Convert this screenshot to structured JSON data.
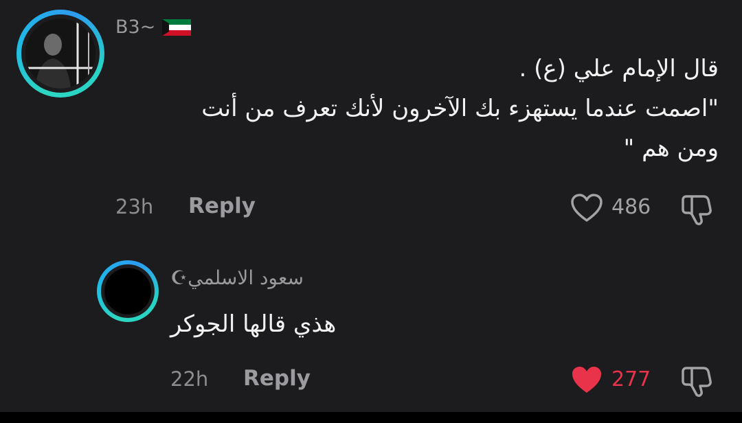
{
  "colors": {
    "background": "#1c1c1e",
    "text": "#f2f2f2",
    "muted": "#8d8d91",
    "liked": "#e8334a",
    "ring": "#2dd6c1"
  },
  "comments": [
    {
      "username": "B3~",
      "badge_icon": "kuwait-flag-icon",
      "lines": [
        "قال الإمام علي (ع) .",
        "\"اصمت عندما يستهزء بك الآخرون لأنك تعرف من أنت",
        "ومن هم \""
      ],
      "time": "23h",
      "reply_label": "Reply",
      "like_count": "486",
      "liked": false,
      "like_icon": "heart-outline-icon",
      "dislike_icon": "thumbs-down-icon"
    },
    {
      "username": "سعود الاسلمي☪",
      "lines": [
        "هذي قالها الجوكر"
      ],
      "time": "22h",
      "reply_label": "Reply",
      "like_count": "277",
      "liked": true,
      "like_icon": "heart-filled-icon",
      "dislike_icon": "thumbs-down-icon"
    }
  ]
}
